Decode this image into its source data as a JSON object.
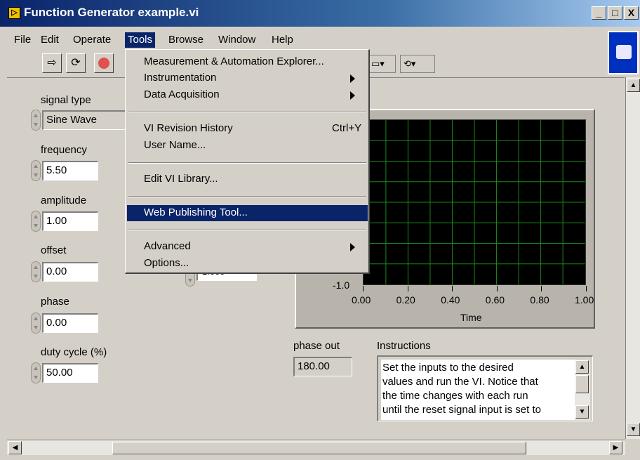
{
  "window": {
    "title": "Function Generator example.vi",
    "buttons": {
      "minimize": "_",
      "maximize": "□",
      "close": "X"
    }
  },
  "menubar": {
    "items": [
      {
        "label": "File"
      },
      {
        "label": "Edit"
      },
      {
        "label": "Operate"
      },
      {
        "label": "Tools"
      },
      {
        "label": "Browse"
      },
      {
        "label": "Window"
      },
      {
        "label": "Help"
      }
    ],
    "active": "Tools"
  },
  "toolbar": {
    "run_icon": "run-arrow-icon",
    "run_continuous_icon": "run-continuously-icon",
    "abort_icon": "abort-stop-icon",
    "align_icon": "align-objects-icon",
    "reorder_icon": "reorder-icon"
  },
  "tools_menu": {
    "items": [
      {
        "label": "Measurement & Automation Explorer...",
        "shortcut": "",
        "submenu": false
      },
      {
        "label": "Instrumentation",
        "shortcut": "",
        "submenu": true
      },
      {
        "label": "Data Acquisition",
        "shortcut": "",
        "submenu": true
      },
      {
        "label": "VI Revision History",
        "shortcut": "Ctrl+Y",
        "submenu": false
      },
      {
        "label": "User Name...",
        "shortcut": "",
        "submenu": false
      },
      {
        "label": "Edit VI Library...",
        "shortcut": "",
        "submenu": false
      },
      {
        "label": "Web Publishing Tool...",
        "shortcut": "",
        "submenu": false,
        "highlighted": true
      },
      {
        "label": "Advanced",
        "shortcut": "",
        "submenu": true
      },
      {
        "label": "Options...",
        "shortcut": "",
        "submenu": false
      }
    ]
  },
  "controls": {
    "signal_type": {
      "label": "signal type",
      "value": "Sine Wave"
    },
    "frequency": {
      "label": "frequency",
      "value": "5.50"
    },
    "amplitude": {
      "label": "amplitude",
      "value": "1.00"
    },
    "offset": {
      "label": "offset",
      "value": "0.00"
    },
    "phase": {
      "label": "phase",
      "value": "0.00"
    },
    "duty_cycle": {
      "label": "duty cycle (%)",
      "value": "50.00"
    },
    "sample_clock_partial": {
      "value": "1.000"
    }
  },
  "indicators": {
    "phase_out": {
      "label": "phase out",
      "value": "180.00"
    }
  },
  "instructions": {
    "label": "Instructions",
    "lines": [
      "Set the inputs to the desired",
      "values and run the VI.  Notice that",
      "the time changes with each run",
      "until the reset signal input is set to"
    ]
  },
  "chart_data": {
    "type": "line",
    "title": "",
    "xlabel": "Time",
    "ylabel": "",
    "x_ticks": [
      "0.00",
      "0.20",
      "0.40",
      "0.60",
      "0.80",
      "1.00"
    ],
    "y_ticks_visible": [
      "-1.0"
    ],
    "xlim": [
      0,
      1
    ],
    "ylim": [
      -1,
      1
    ],
    "grid": true,
    "grid_color": "#1a8a1a",
    "background": "#000000",
    "series": []
  }
}
